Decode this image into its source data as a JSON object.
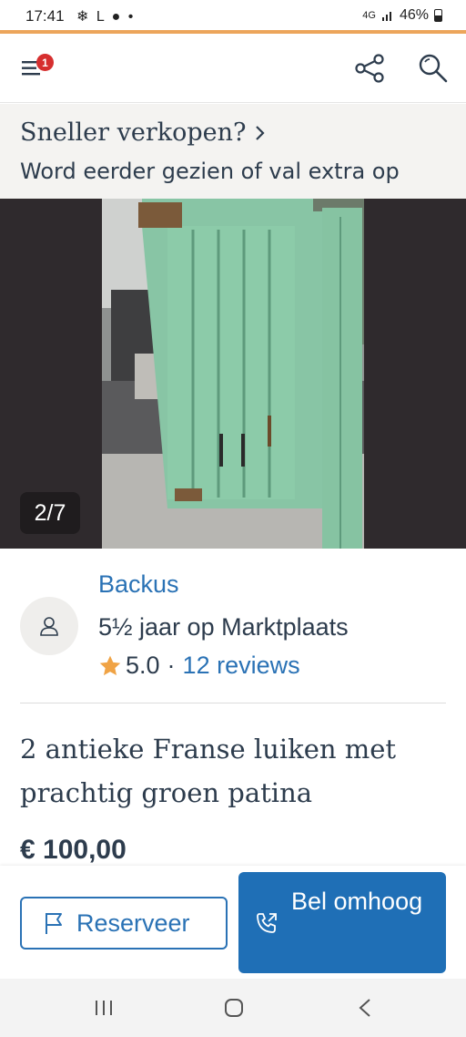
{
  "status_bar": {
    "time": "17:41",
    "left_icons": "❄ L ● •",
    "network": "4G",
    "battery": "46%"
  },
  "app_bar": {
    "notification_count": "1",
    "icons": [
      "menu-icon",
      "share-icon",
      "search-icon"
    ]
  },
  "promo": {
    "title": "Sneller verkopen?",
    "subtitle": "Word eerder gezien of val extra op"
  },
  "gallery": {
    "counter": "2/7"
  },
  "seller": {
    "name": "Backus",
    "member_since": "5½ jaar op Marktplaats",
    "rating": "5.0",
    "separator": "·",
    "reviews": "12 reviews"
  },
  "listing": {
    "title": "2 antieke Franse luiken met prachtig groen patina",
    "price": "€ 100,00"
  },
  "actions": {
    "reserve_label": "Reserveer",
    "bel_label": "Bel omhoog"
  },
  "colors": {
    "accent": "#eca55b",
    "link": "#2a72b5",
    "primary_button": "#1f6fb6",
    "text": "#2d3c4d",
    "star": "#f0a345"
  }
}
